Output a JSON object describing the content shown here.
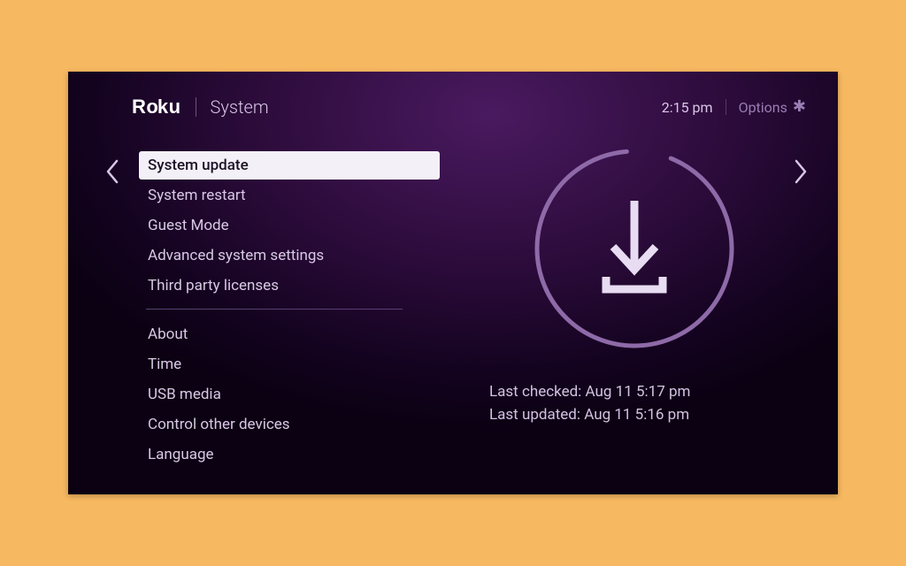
{
  "header": {
    "logo": "Roku",
    "breadcrumb": "System",
    "clock": "2:15  pm",
    "options_label": "Options"
  },
  "menu": {
    "group1": [
      "System update",
      "System restart",
      "Guest Mode",
      "Advanced system settings",
      "Third party licenses"
    ],
    "group2": [
      "About",
      "Time",
      "USB media",
      "Control other devices",
      "Language"
    ],
    "selected_index": 0
  },
  "update": {
    "last_checked": "Last checked: Aug 11  5:17 pm",
    "last_updated": "Last updated: Aug 11  5:16 pm"
  }
}
